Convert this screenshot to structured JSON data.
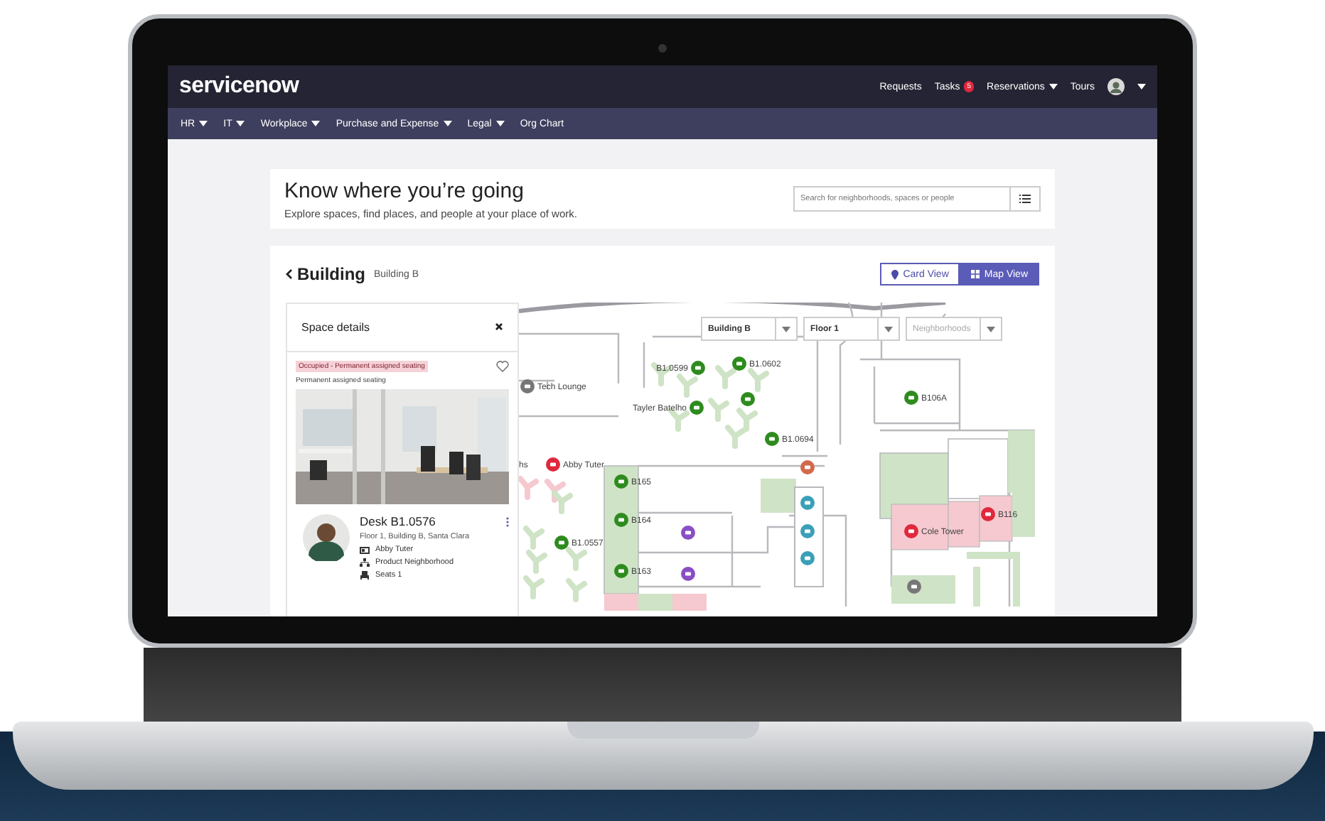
{
  "top_bar": {
    "logo": "servicenow",
    "links": [
      {
        "label": "Requests",
        "kind": "link"
      },
      {
        "label": "Tasks",
        "kind": "badge",
        "badge": "5"
      },
      {
        "label": "Reservations",
        "kind": "menu"
      },
      {
        "label": "Tours",
        "kind": "link"
      }
    ]
  },
  "nav": [
    {
      "label": "HR",
      "has_menu": true
    },
    {
      "label": "IT",
      "has_menu": true
    },
    {
      "label": "Workplace",
      "has_menu": true
    },
    {
      "label": "Purchase and Expense",
      "has_menu": true
    },
    {
      "label": "Legal",
      "has_menu": true
    },
    {
      "label": "Org Chart",
      "has_menu": false
    }
  ],
  "hero": {
    "title": "Know where you’re going",
    "subtitle": "Explore spaces, find places, and people at your place of work.",
    "search": {
      "placeholder": "Search for neighborhoods, spaces or people"
    }
  },
  "building": {
    "title": "Building",
    "subtitle": "Building B",
    "views": [
      {
        "label": "Card View",
        "selected": false
      },
      {
        "label": "Map View",
        "selected": true
      }
    ]
  },
  "space_details": {
    "title": "Space details",
    "status": "Occupied - Permanent assigned seating",
    "note": "Permanent assigned seating",
    "desk": "Desk B1.0576",
    "location": "Floor 1, Building B,  Santa Clara",
    "facts": [
      {
        "text": "Abby Tuter"
      },
      {
        "text": "Product Neighborhood"
      },
      {
        "text": "Seats 1"
      }
    ]
  },
  "map": {
    "filters": [
      {
        "value": "Building B"
      },
      {
        "value": "Floor 1"
      },
      {
        "placeholder": "Neighborhoods"
      }
    ],
    "cut_text": "hs",
    "pins": [
      {
        "label": "B1.0599",
        "color": "#2e8b1e"
      },
      {
        "label": "B1.0602",
        "color": "#2e8b1e"
      },
      {
        "label": "Tech Lounge",
        "color": "#777777"
      },
      {
        "color": "#2e8b1e"
      },
      {
        "label": "Tayler Batelho",
        "color": "#2e8b1e"
      },
      {
        "label": "B1.0694",
        "color": "#2e8b1e"
      },
      {
        "label": "B106A",
        "color": "#2e8b1e"
      },
      {
        "label": "Abby Tuter",
        "color": "#e0283c"
      },
      {
        "color": "#d2694a"
      },
      {
        "label": "B165",
        "color": "#2e8b1e"
      },
      {
        "color": "#3aa0b8"
      },
      {
        "label": "B164",
        "color": "#2e8b1e"
      },
      {
        "color": "#8a4fc4"
      },
      {
        "color": "#3aa0b8"
      },
      {
        "label": "B1.0557",
        "color": "#2e8b1e"
      },
      {
        "label": "B163",
        "color": "#2e8b1e"
      },
      {
        "color": "#8a4fc4"
      },
      {
        "color": "#3aa0b8"
      },
      {
        "label": "Cole Tower",
        "color": "#e0283c"
      },
      {
        "label": "B116",
        "color": "#e0283c"
      },
      {
        "color": "#777777"
      }
    ]
  }
}
